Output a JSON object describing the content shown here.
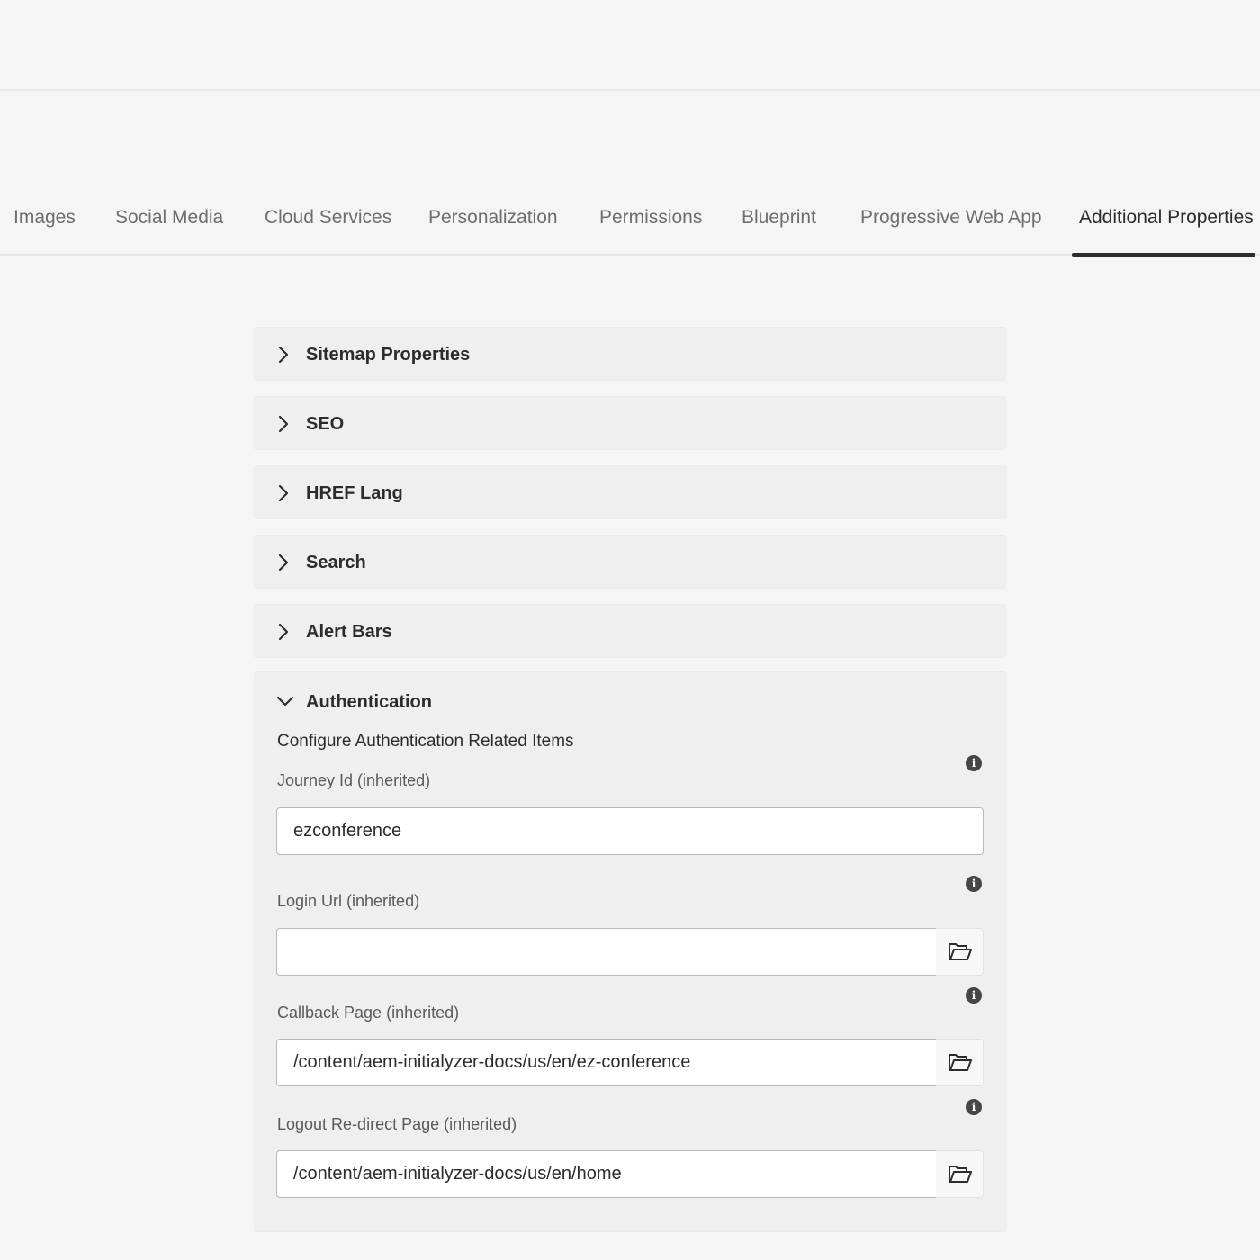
{
  "tabs": [
    {
      "label": "Images",
      "active": false
    },
    {
      "label": "Social Media",
      "active": false
    },
    {
      "label": "Cloud Services",
      "active": false
    },
    {
      "label": "Personalization",
      "active": false
    },
    {
      "label": "Permissions",
      "active": false
    },
    {
      "label": "Blueprint",
      "active": false
    },
    {
      "label": "Progressive Web App",
      "active": false
    },
    {
      "label": "Additional Properties",
      "active": true
    }
  ],
  "panels": [
    {
      "title": "Sitemap Properties",
      "expanded": false,
      "icon": "chevron-right-icon"
    },
    {
      "title": "SEO",
      "expanded": false,
      "icon": "chevron-right-icon"
    },
    {
      "title": "HREF Lang",
      "expanded": false,
      "icon": "chevron-right-icon"
    },
    {
      "title": "Search",
      "expanded": false,
      "icon": "chevron-right-icon"
    },
    {
      "title": "Alert Bars",
      "expanded": false,
      "icon": "chevron-right-icon"
    }
  ],
  "authentication": {
    "title": "Authentication",
    "expanded": true,
    "icon": "chevron-down-icon",
    "description": "Configure Authentication Related Items",
    "fields": {
      "journey_id": {
        "label": "Journey Id (inherited)",
        "value": "ezconference",
        "info_icon": "info-icon"
      },
      "login_url": {
        "label": "Login Url (inherited)",
        "value": "",
        "info_icon": "info-icon",
        "browse_icon": "folder-open-icon"
      },
      "callback_page": {
        "label": "Callback Page (inherited)",
        "value": "/content/aem-initialyzer-docs/us/en/ez-conference",
        "info_icon": "info-icon",
        "browse_icon": "folder-open-icon"
      },
      "logout_redirect_page": {
        "label": "Logout Re-direct Page (inherited)",
        "value": "/content/aem-initialyzer-docs/us/en/home",
        "info_icon": "info-icon",
        "browse_icon": "folder-open-icon"
      }
    }
  },
  "colors": {
    "background": "#f5f5f5",
    "panel": "#efefef",
    "text": "#2c2c2c",
    "muted_text": "#6e6e6e",
    "active_indicator": "#2c2c2c"
  }
}
